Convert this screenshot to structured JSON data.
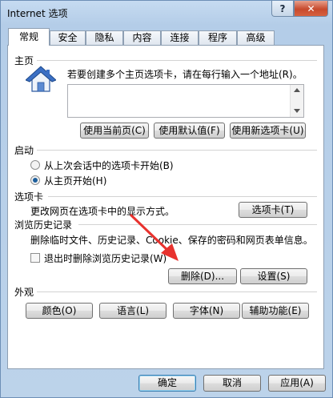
{
  "window": {
    "title": "Internet 选项",
    "help_glyph": "?",
    "close_glyph": "✕"
  },
  "tabs": [
    {
      "label": "常规",
      "active": true
    },
    {
      "label": "安全"
    },
    {
      "label": "隐私"
    },
    {
      "label": "内容"
    },
    {
      "label": "连接"
    },
    {
      "label": "程序"
    },
    {
      "label": "高级"
    }
  ],
  "homepage": {
    "title": "主页",
    "instruction": "若要创建多个主页选项卡，请在每行输入一个地址(R)。",
    "value": "",
    "use_current": "使用当前页(C)",
    "use_default": "使用默认值(F)",
    "use_new_tab": "使用新选项卡(U)"
  },
  "startup": {
    "title": "启动",
    "option_last_session": "从上次会话中的选项卡开始(B)",
    "option_homepage": "从主页开始(H)",
    "selected": "homepage"
  },
  "tabs_section": {
    "title": "选项卡",
    "description": "更改网页在选项卡中的显示方式。",
    "button": "选项卡(T)"
  },
  "history": {
    "title": "浏览历史记录",
    "description": "删除临时文件、历史记录、Cookie、保存的密码和网页表单信息。",
    "delete_on_exit": "退出时删除浏览历史记录(W)",
    "delete_on_exit_checked": false,
    "delete_button": "删除(D)...",
    "settings_button": "设置(S)"
  },
  "appearance": {
    "title": "外观",
    "colors": "颜色(O)",
    "languages": "语言(L)",
    "fonts": "字体(N)",
    "accessibility": "辅助功能(E)"
  },
  "footer": {
    "ok": "确定",
    "cancel": "取消",
    "apply": "应用(A)"
  },
  "colors": {
    "arrow": "#e8322e",
    "house_roof": "#3a6fc4",
    "house_wall": "#eef3fa"
  }
}
